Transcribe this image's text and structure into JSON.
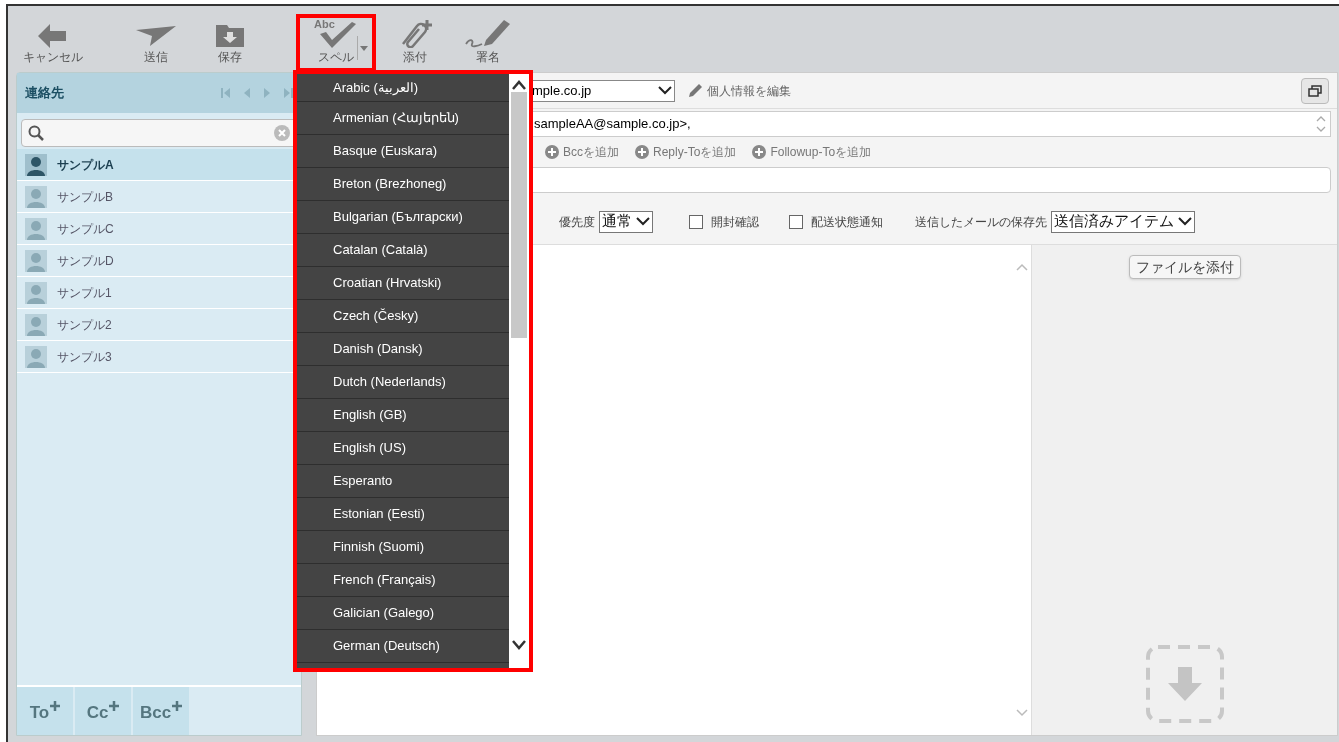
{
  "toolbar": {
    "buttons": [
      {
        "kind": "cancel",
        "label": "キャンセル",
        "highlighted": false
      },
      {
        "kind": "send",
        "label": "送信",
        "highlighted": false
      },
      {
        "kind": "save",
        "label": "保存",
        "highlighted": false
      },
      {
        "kind": "spell",
        "label": "スペル",
        "icon_text": "Abc",
        "highlighted": true
      },
      {
        "kind": "attach",
        "label": "添付",
        "highlighted": false
      },
      {
        "kind": "signature",
        "label": "署名",
        "highlighted": false
      }
    ]
  },
  "contacts": {
    "title": "連絡先",
    "items": [
      {
        "name": "サンプルA",
        "selected": true
      },
      {
        "name": "サンプルB",
        "selected": false
      },
      {
        "name": "サンプルC",
        "selected": false
      },
      {
        "name": "サンプルD",
        "selected": false
      },
      {
        "name": "サンプル1",
        "selected": false
      },
      {
        "name": "サンプル2",
        "selected": false
      },
      {
        "name": "サンプル3",
        "selected": false
      }
    ],
    "recipient_buttons": [
      "To",
      "Cc",
      "Bcc"
    ]
  },
  "compose": {
    "from_value": "mple.co.jp",
    "edit_profile": "個人情報を編集",
    "to_value": "sampleAA@sample.co.jp>,",
    "add_links": [
      "Bccを追加",
      "Reply-Toを追加",
      "Followup-Toを追加"
    ],
    "priority_label": "優先度",
    "priority_value": "通常",
    "checkboxes": [
      {
        "label": "開封確認",
        "checked": false
      },
      {
        "label": "配送状態通知",
        "checked": false
      }
    ],
    "save_label": "送信したメールの保存先",
    "save_value": "送信済みアイテム",
    "attach_button": "ファイルを添付"
  },
  "spell_menu": {
    "highlighted": true,
    "items": [
      "Arabic (العربية)",
      "Armenian (Հայերեն)",
      "Basque (Euskara)",
      "Breton (Brezhoneg)",
      "Bulgarian (Български)",
      "Catalan (Català)",
      "Croatian (Hrvatski)",
      "Czech (Česky)",
      "Danish (Dansk)",
      "Dutch (Nederlands)",
      "English (GB)",
      "English (US)",
      "Esperanto",
      "Estonian (Eesti)",
      "Finnish (Suomi)",
      "French (Français)",
      "Galician (Galego)",
      "German (Deutsch)"
    ]
  }
}
